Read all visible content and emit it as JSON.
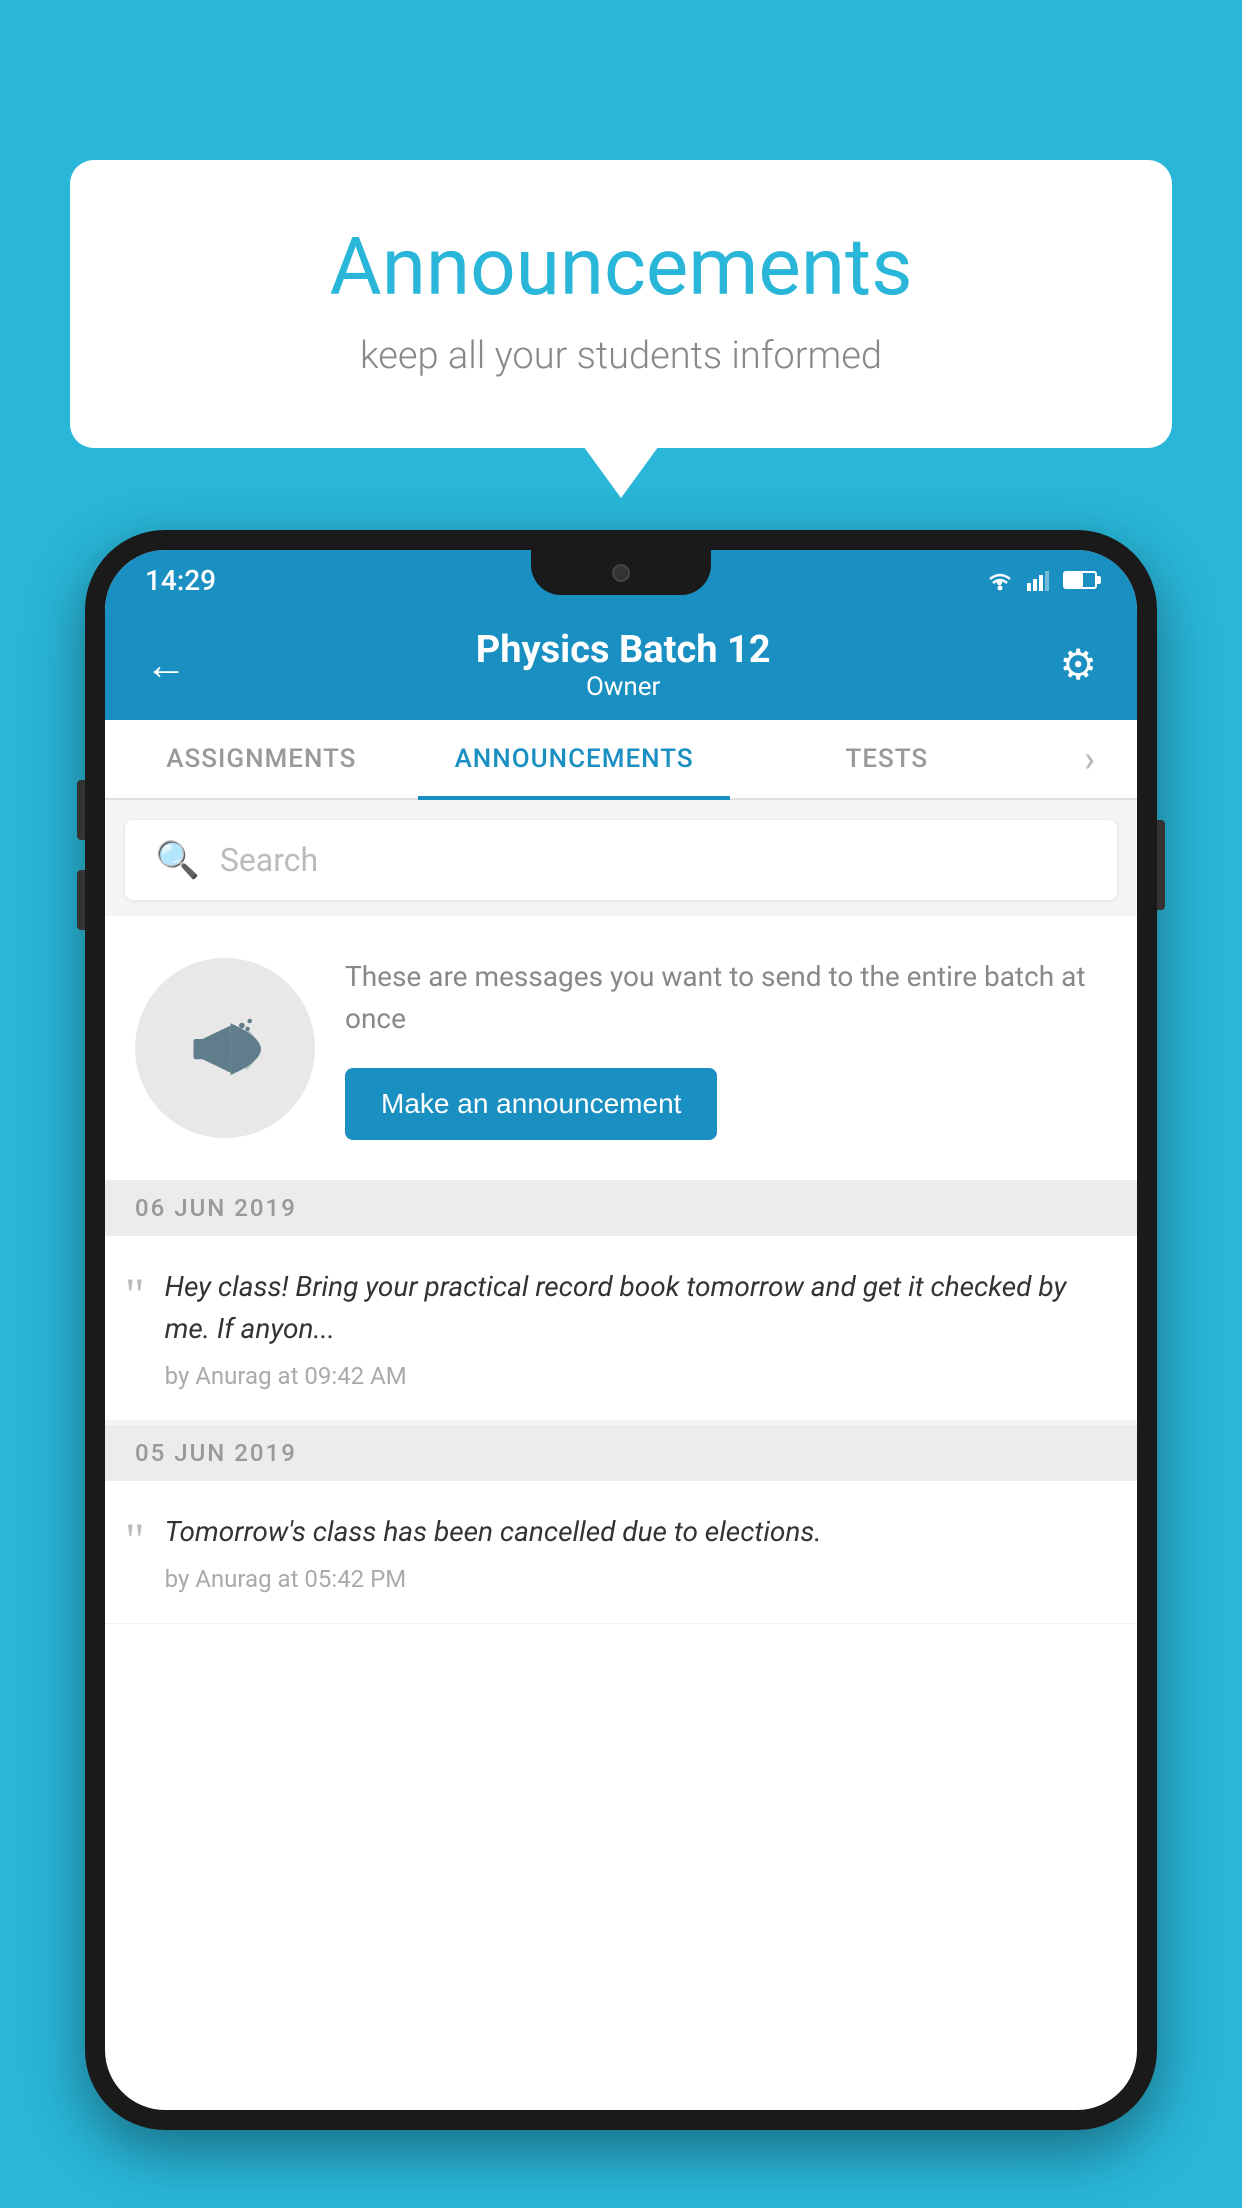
{
  "background_color": "#29b6d8",
  "speech_bubble": {
    "title": "Announcements",
    "subtitle": "keep all your students informed"
  },
  "status_bar": {
    "time": "14:29",
    "wifi": true,
    "signal": true,
    "battery": true
  },
  "header": {
    "title": "Physics Batch 12",
    "subtitle": "Owner",
    "back_label": "←",
    "settings_label": "⚙"
  },
  "tabs": [
    {
      "id": "assignments",
      "label": "ASSIGNMENTS",
      "active": false
    },
    {
      "id": "announcements",
      "label": "ANNOUNCEMENTS",
      "active": true
    },
    {
      "id": "tests",
      "label": "TESTS",
      "active": false
    },
    {
      "id": "more",
      "label": "›",
      "active": false
    }
  ],
  "search": {
    "placeholder": "Search"
  },
  "cta": {
    "description": "These are messages you want to send to the entire batch at once",
    "button_label": "Make an announcement"
  },
  "announcements": [
    {
      "date": "06  JUN  2019",
      "message": "Hey class! Bring your practical record book tomorrow and get it checked by me. If anyon...",
      "author": "by Anurag at 09:42 AM"
    },
    {
      "date": "05  JUN  2019",
      "message": "Tomorrow's class has been cancelled due to elections.",
      "author": "by Anurag at 05:42 PM"
    }
  ]
}
